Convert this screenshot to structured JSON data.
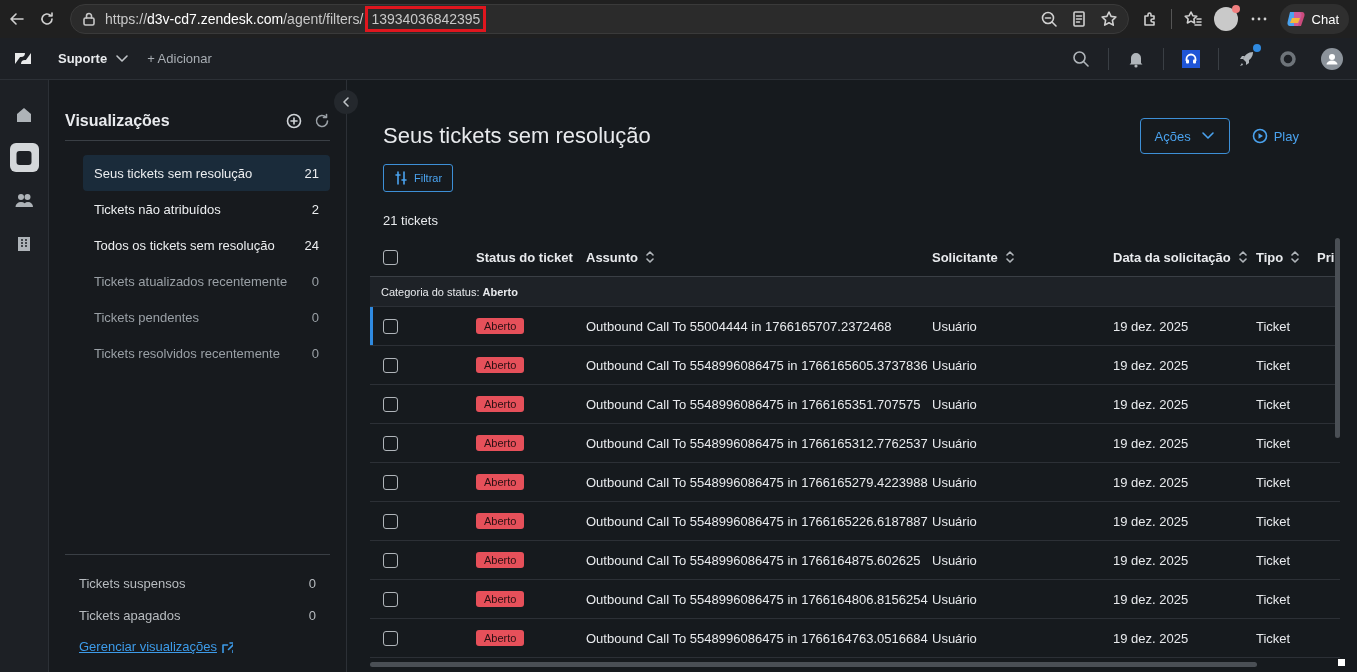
{
  "browser": {
    "url_parts": [
      {
        "text": "https://",
        "kind": "dim"
      },
      {
        "text": "d3v-cd7.zendesk.com",
        "kind": "bright"
      },
      {
        "text": "/agent/filters/",
        "kind": "dim"
      },
      {
        "text": "13934036842395",
        "kind": "boxed"
      }
    ],
    "chat_label": "Chat"
  },
  "app_header": {
    "product": "Suporte",
    "add_label": "+ Adicionar"
  },
  "rail": [
    {
      "kind": "home",
      "selected": false
    },
    {
      "kind": "inbox",
      "selected": true
    },
    {
      "kind": "people",
      "selected": false
    },
    {
      "kind": "building",
      "selected": false
    }
  ],
  "sidebar": {
    "title": "Visualizações",
    "items": [
      {
        "label": "Seus tickets sem resolução",
        "count": "21",
        "selected": true,
        "muted": false
      },
      {
        "label": "Tickets não atribuídos",
        "count": "2",
        "selected": false,
        "muted": false
      },
      {
        "label": "Todos os tickets sem resolução",
        "count": "24",
        "selected": false,
        "muted": false
      },
      {
        "label": "Tickets atualizados recentemente",
        "count": "0",
        "selected": false,
        "muted": true
      },
      {
        "label": "Tickets pendentes",
        "count": "0",
        "selected": false,
        "muted": true
      },
      {
        "label": "Tickets resolvidos recentemente",
        "count": "0",
        "selected": false,
        "muted": true
      }
    ],
    "footer_items": [
      {
        "label": "Tickets suspensos",
        "count": "0"
      },
      {
        "label": "Tickets apagados",
        "count": "0"
      }
    ],
    "manage_link": "Gerenciar visualizações"
  },
  "main": {
    "title": "Seus tickets sem resolução",
    "actions_label": "Ações",
    "play_label": "Play",
    "filter_label": "Filtrar",
    "ticket_count": "21 tickets"
  },
  "table": {
    "select_all_checked": false,
    "columns": [
      {
        "label": "Status do ticket"
      },
      {
        "label": "Assunto",
        "sortable": true
      },
      {
        "label": "Solicitante",
        "sortable": true
      },
      {
        "label": "Data da solicitação",
        "sortable": true
      },
      {
        "label": "Tipo",
        "sortable": true
      },
      {
        "label": "Pri"
      }
    ],
    "group_label": "Categoria do status: **Aberto**",
    "rows": [
      {
        "status": "Aberto",
        "subject": "Outbound Call To 55004444 in 1766165707.2372468",
        "requester": "Usuário",
        "date": "19 dez. 2025",
        "type": "Ticket",
        "checked": false,
        "focused": true
      },
      {
        "status": "Aberto",
        "subject": "Outbound Call To 5548996086475 in 1766165605.3737836",
        "requester": "Usuário",
        "date": "19 dez. 2025",
        "type": "Ticket",
        "checked": false,
        "focused": false
      },
      {
        "status": "Aberto",
        "subject": "Outbound Call To 5548996086475 in 1766165351.707575",
        "requester": "Usuário",
        "date": "19 dez. 2025",
        "type": "Ticket",
        "checked": false,
        "focused": false
      },
      {
        "status": "Aberto",
        "subject": "Outbound Call To 5548996086475 in 1766165312.7762537",
        "requester": "Usuário",
        "date": "19 dez. 2025",
        "type": "Ticket",
        "checked": false,
        "focused": false
      },
      {
        "status": "Aberto",
        "subject": "Outbound Call To 5548996086475 in 1766165279.4223988",
        "requester": "Usuário",
        "date": "19 dez. 2025",
        "type": "Ticket",
        "checked": false,
        "focused": false
      },
      {
        "status": "Aberto",
        "subject": "Outbound Call To 5548996086475 in 1766165226.6187887",
        "requester": "Usuário",
        "date": "19 dez. 2025",
        "type": "Ticket",
        "checked": false,
        "focused": false
      },
      {
        "status": "Aberto",
        "subject": "Outbound Call To 5548996086475 in 1766164875.602625",
        "requester": "Usuário",
        "date": "19 dez. 2025",
        "type": "Ticket",
        "checked": false,
        "focused": false
      },
      {
        "status": "Aberto",
        "subject": "Outbound Call To 5548996086475 in 1766164806.8156254",
        "requester": "Usuário",
        "date": "19 dez. 2025",
        "type": "Ticket",
        "checked": false,
        "focused": false
      },
      {
        "status": "Aberto",
        "subject": "Outbound Call To 5548996086475 in 1766164763.0516684",
        "requester": "Usuário",
        "date": "19 dez. 2025",
        "type": "Ticket",
        "checked": false,
        "focused": false
      }
    ]
  }
}
